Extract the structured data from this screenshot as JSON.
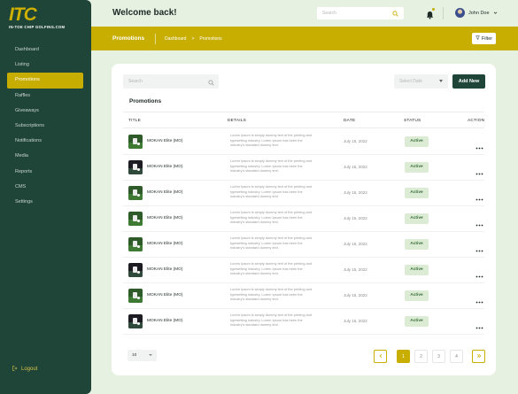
{
  "sidebar": {
    "logo": {
      "letters": "ITC",
      "subtitle": "IN-TOE CHIP GOLFING.COM"
    },
    "items": [
      {
        "label": "Dashboard",
        "active": false
      },
      {
        "label": "Listing",
        "active": false
      },
      {
        "label": "Promotions",
        "active": true
      },
      {
        "label": "Raffles",
        "active": false
      },
      {
        "label": "Giveaways",
        "active": false
      },
      {
        "label": "Subscriptions",
        "active": false
      },
      {
        "label": "Notifications",
        "active": false
      },
      {
        "label": "Media",
        "active": false
      },
      {
        "label": "Reports",
        "active": false
      },
      {
        "label": "CMS",
        "active": false
      },
      {
        "label": "Settings",
        "active": false
      }
    ],
    "logout_label": "Logout"
  },
  "header": {
    "welcome": "Welcome back!",
    "search_placeholder": "Search",
    "user_name": "John Doe"
  },
  "banner": {
    "title": "Promotions",
    "breadcrumb": [
      "Dashboard",
      ">",
      "Promotions"
    ],
    "filter_label": "Filter"
  },
  "main": {
    "search_placeholder": "Search",
    "date_select": "Select Date",
    "add_label": "Add New",
    "section_title": "Promotions",
    "columns": [
      "TITLE",
      "DETAILS",
      "DATE",
      "STATUS",
      "ACTION"
    ],
    "rows": [
      {
        "title": "MOKAN Elite (MO)",
        "details": "Lorem Ipsum is simply dummy text of the printing and typesetting industry. Lorem Ipsum has been the industry's standard dummy text.",
        "date": "July 15, 2022",
        "status": "Active",
        "thumb": "light"
      },
      {
        "title": "MOKAN Elite (MO)",
        "details": "Lorem Ipsum is simply dummy text of the printing and typesetting industry. Lorem Ipsum has been the industry's standard dummy text.",
        "date": "July 15, 2022",
        "status": "Active",
        "thumb": "dark"
      },
      {
        "title": "MOKAN Elite (MO)",
        "details": "Lorem Ipsum is simply dummy text of the printing and typesetting industry. Lorem Ipsum has been the industry's standard dummy text.",
        "date": "July 15, 2022",
        "status": "Active",
        "thumb": "light"
      },
      {
        "title": "MOKAN Elite (MO)",
        "details": "Lorem Ipsum is simply dummy text of the printing and typesetting industry. Lorem Ipsum has been the industry's standard dummy text.",
        "date": "July 15, 2022",
        "status": "Active",
        "thumb": "light"
      },
      {
        "title": "MOKAN Elite (MO)",
        "details": "Lorem Ipsum is simply dummy text of the printing and typesetting industry. Lorem Ipsum has been the industry's standard dummy text.",
        "date": "July 15, 2022",
        "status": "Active",
        "thumb": "light"
      },
      {
        "title": "MOKAN Elite (MO)",
        "details": "Lorem Ipsum is simply dummy text of the printing and typesetting industry. Lorem Ipsum has been the industry's standard dummy text.",
        "date": "July 15, 2022",
        "status": "Active",
        "thumb": "dark"
      },
      {
        "title": "MOKAN Elite (MO)",
        "details": "Lorem Ipsum is simply dummy text of the printing and typesetting industry. Lorem Ipsum has been the industry's standard dummy text.",
        "date": "July 15, 2022",
        "status": "Active",
        "thumb": "light"
      },
      {
        "title": "MOKAN Elite (MO)",
        "details": "Lorem Ipsum is simply dummy text of the printing and typesetting industry. Lorem Ipsum has been the industry's standard dummy text.",
        "date": "July 15, 2022",
        "status": "Active",
        "thumb": "dark"
      }
    ],
    "per_page": "10",
    "pages": [
      "1",
      "2",
      "3",
      "4"
    ],
    "current_page": "1"
  },
  "colors": {
    "sidebar": "#1f4438",
    "accent": "#c8ae00",
    "background": "#e6f1e2",
    "badge_bg": "#dcebd4",
    "badge_text": "#3a6e3a"
  }
}
